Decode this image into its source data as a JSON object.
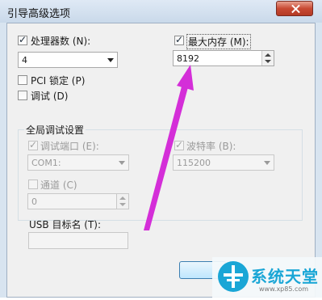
{
  "window": {
    "title": "引导高级选项"
  },
  "cpu": {
    "label": "处理器数 (N):",
    "checked": true,
    "value": "4"
  },
  "max_memory": {
    "label": "最大内存 (M):",
    "checked": true,
    "value": "8192"
  },
  "pci_lock": {
    "label": "PCI 锁定 (P)",
    "checked": false
  },
  "debug": {
    "label": "调试 (D)",
    "checked": false
  },
  "global_debug": {
    "title": "全局调试设置",
    "debug_port": {
      "label": "调试端口 (E):",
      "checked": true,
      "value": "COM1:"
    },
    "baud_rate": {
      "label": "波特率 (B):",
      "checked": true,
      "value": "115200"
    },
    "channel": {
      "label": "通道 (C)",
      "checked": false,
      "value": "0"
    },
    "usb_target": {
      "label": "USB 目标名 (T):",
      "value": ""
    }
  },
  "watermark": {
    "brand": "系统天堂",
    "url": "www.xp85.com"
  },
  "colors": {
    "arrow": "#d42ed8",
    "accent": "#1aa6d6"
  }
}
